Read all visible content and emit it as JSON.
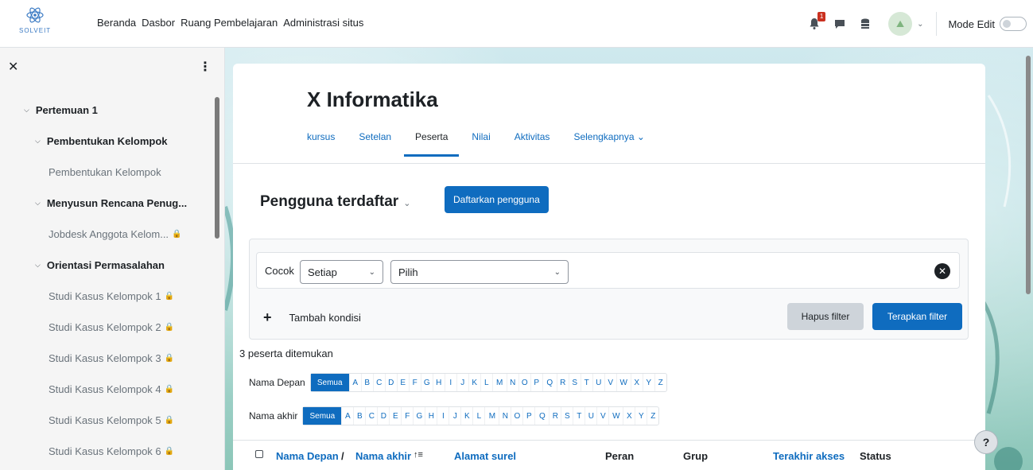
{
  "brand": {
    "name": "SOLVEIT"
  },
  "topnav": [
    "Beranda",
    "Dasbor",
    "Ruang Pembelajaran",
    "Administrasi situs"
  ],
  "header": {
    "notification_count": "1",
    "mode_edit_label": "Mode Edit"
  },
  "drawer": {
    "items": [
      {
        "level": "section",
        "label": "Pertemuan 1"
      },
      {
        "level": "sub",
        "label": "Pembentukan Kelompok"
      },
      {
        "level": "activity",
        "label": "Pembentukan Kelompok",
        "locked": false
      },
      {
        "level": "sub",
        "label": "Menyusun Rencana Penug..."
      },
      {
        "level": "activity",
        "label": "Jobdesk Anggota Kelom...",
        "locked": true
      },
      {
        "level": "sub",
        "label": "Orientasi Permasalahan"
      },
      {
        "level": "activity",
        "label": "Studi Kasus Kelompok 1",
        "locked": true
      },
      {
        "level": "activity",
        "label": "Studi Kasus Kelompok 2",
        "locked": true
      },
      {
        "level": "activity",
        "label": "Studi Kasus Kelompok 3",
        "locked": true
      },
      {
        "level": "activity",
        "label": "Studi Kasus Kelompok 4",
        "locked": true
      },
      {
        "level": "activity",
        "label": "Studi Kasus Kelompok 5",
        "locked": true
      },
      {
        "level": "activity",
        "label": "Studi Kasus Kelompok 6",
        "locked": true
      }
    ]
  },
  "course": {
    "title": "X Informatika",
    "tabs": [
      {
        "label": "kursus",
        "active": false
      },
      {
        "label": "Setelan",
        "active": false
      },
      {
        "label": "Peserta",
        "active": true
      },
      {
        "label": "Nilai",
        "active": false
      },
      {
        "label": "Aktivitas",
        "active": false
      },
      {
        "label": "Selengkapnya ⌄",
        "active": false
      }
    ]
  },
  "participants": {
    "heading": "Pengguna terdaftar",
    "enrol_button": "Daftarkan pengguna",
    "filter": {
      "match_label": "Cocok",
      "match_value": "Setiap",
      "select_value": "Pilih",
      "add_condition": "Tambah kondisi",
      "clear_button": "Hapus filter",
      "apply_button": "Terapkan filter"
    },
    "found_text": "3 peserta ditemukan",
    "firstname_label": "Nama Depan",
    "lastname_label": "Nama akhir",
    "all_label": "Semua",
    "letters": [
      "A",
      "B",
      "C",
      "D",
      "E",
      "F",
      "G",
      "H",
      "I",
      "J",
      "K",
      "L",
      "M",
      "N",
      "O",
      "P",
      "Q",
      "R",
      "S",
      "T",
      "U",
      "V",
      "W",
      "X",
      "Y",
      "Z"
    ],
    "columns": {
      "first": "Nama Depan",
      "slash": "/",
      "last": "Nama akhir",
      "sort_icon": "↑≡",
      "email": "Alamat surel",
      "role": "Peran",
      "group": "Grup",
      "last_access": "Terakhir akses",
      "status": "Status"
    }
  },
  "help": "?"
}
